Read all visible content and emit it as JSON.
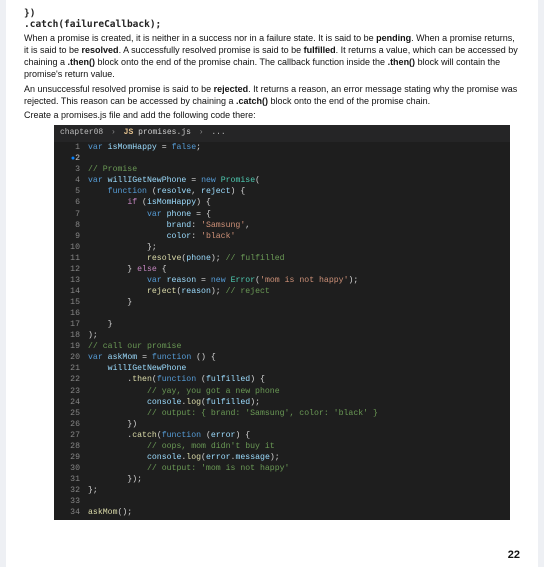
{
  "header_code": {
    "line1": "})",
    "line2": ".catch(failureCallback);"
  },
  "prose": {
    "p1a": "When a promise is created, it is neither in a success nor in a failure state. It is said to be ",
    "p1b": "pending",
    "p1c": ". When a promise returns, it is said to be ",
    "p1d": "resolved",
    "p1e": ". A successfully resolved promise is said to be ",
    "p1f": "fulfilled",
    "p1g": ". It returns a value, which can be accessed by chaining a ",
    "p1h": ".then()",
    "p1i": " block onto the end of the promise chain. The callback function inside the ",
    "p1j": ".then()",
    "p1k": " block will contain the promise's return value.",
    "p2a": "An unsuccessful resolved promise is said to be ",
    "p2b": "rejected",
    "p2c": ". It returns a reason, an error message stating why the promise was rejected. This reason can be accessed by chaining a ",
    "p2d": ".catch()",
    "p2e": " block onto the end of the promise chain.",
    "p3": "Create a promises.js file and add the following code there:"
  },
  "tab": {
    "folder": "chapter08",
    "kind": "JS",
    "file": "promises.js",
    "tail": "..."
  },
  "code": [
    {
      "n": 1,
      "t": "<span class='kw'>var</span> <span class='var'>isMomHappy</span> <span class='op'>=</span> <span class='kw'>false</span>;"
    },
    {
      "n": 2,
      "t": "",
      "active": true
    },
    {
      "n": 3,
      "t": "<span class='cmnt'>// Promise</span>"
    },
    {
      "n": 4,
      "t": "<span class='kw'>var</span> <span class='var'>willIGetNewPhone</span> <span class='op'>=</span> <span class='kw'>new</span> <span class='cls'>Promise</span>("
    },
    {
      "n": 5,
      "t": "    <span class='kw'>function</span> (<span class='var'>resolve</span>, <span class='var'>reject</span>) {"
    },
    {
      "n": 6,
      "t": "        <span class='kw2'>if</span> (<span class='var'>isMomHappy</span>) {"
    },
    {
      "n": 7,
      "t": "            <span class='kw'>var</span> <span class='var'>phone</span> <span class='op'>=</span> {"
    },
    {
      "n": 8,
      "t": "                <span class='var'>brand</span>: <span class='str'>'Samsung'</span>,"
    },
    {
      "n": 9,
      "t": "                <span class='var'>color</span>: <span class='str'>'black'</span>"
    },
    {
      "n": 10,
      "t": "            };"
    },
    {
      "n": 11,
      "t": "            <span class='fn'>resolve</span>(<span class='var'>phone</span>); <span class='cmnt'>// fulfilled</span>"
    },
    {
      "n": 12,
      "t": "        } <span class='kw2'>else</span> {"
    },
    {
      "n": 13,
      "t": "            <span class='kw'>var</span> <span class='var'>reason</span> <span class='op'>=</span> <span class='kw'>new</span> <span class='cls'>Error</span>(<span class='str'>'mom is not happy'</span>);"
    },
    {
      "n": 14,
      "t": "            <span class='fn'>reject</span>(<span class='var'>reason</span>); <span class='cmnt'>// reject</span>"
    },
    {
      "n": 15,
      "t": "        }"
    },
    {
      "n": 16,
      "t": ""
    },
    {
      "n": 17,
      "t": "    }"
    },
    {
      "n": 18,
      "t": ");"
    },
    {
      "n": 19,
      "t": "<span class='cmnt'>// call our promise</span>"
    },
    {
      "n": 20,
      "t": "<span class='kw'>var</span> <span class='var'>askMom</span> <span class='op'>=</span> <span class='kw'>function</span> () {"
    },
    {
      "n": 21,
      "t": "    <span class='var'>willIGetNewPhone</span>"
    },
    {
      "n": 22,
      "t": "        .<span class='fn'>then</span>(<span class='kw'>function</span> (<span class='var'>fulfilled</span>) {"
    },
    {
      "n": 23,
      "t": "            <span class='cmnt'>// yay, you got a new phone</span>"
    },
    {
      "n": 24,
      "t": "            <span class='var'>console</span>.<span class='fn'>log</span>(<span class='var'>fulfilled</span>);"
    },
    {
      "n": 25,
      "t": "            <span class='cmnt'>// output: { brand: 'Samsung', color: 'black' }</span>"
    },
    {
      "n": 26,
      "t": "        })"
    },
    {
      "n": 27,
      "t": "        .<span class='fn'>catch</span>(<span class='kw'>function</span> (<span class='var'>error</span>) {"
    },
    {
      "n": 28,
      "t": "            <span class='cmnt'>// oops, mom didn't buy it</span>"
    },
    {
      "n": 29,
      "t": "            <span class='var'>console</span>.<span class='fn'>log</span>(<span class='var'>error</span>.<span class='var'>message</span>);"
    },
    {
      "n": 30,
      "t": "            <span class='cmnt'>// output: 'mom is not happy'</span>"
    },
    {
      "n": 31,
      "t": "        });"
    },
    {
      "n": 32,
      "t": "};"
    },
    {
      "n": 33,
      "t": ""
    },
    {
      "n": 34,
      "t": "<span class='fn'>askMom</span>();"
    }
  ],
  "page_number": "22"
}
